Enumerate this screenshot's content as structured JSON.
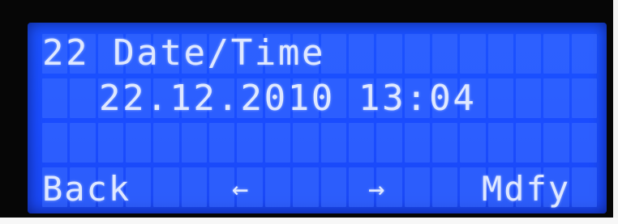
{
  "lcd": {
    "line1": "22 Date/Time",
    "line2": "22.12.2010 13:04",
    "softkeys": {
      "back": "Back",
      "left": "←",
      "right": "→",
      "modify": "Mdfy"
    }
  },
  "colors": {
    "lcd_background": "#1b52ff",
    "lcd_text": "#dfe8ff",
    "bezel": "#060606"
  }
}
